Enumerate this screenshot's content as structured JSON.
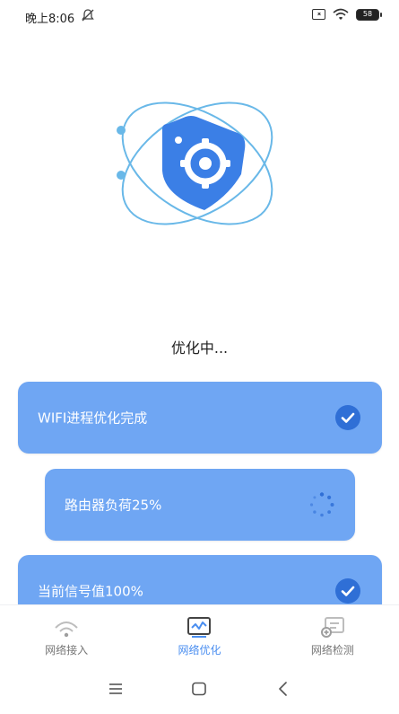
{
  "status_bar": {
    "time": "晚上8:06",
    "battery": "58"
  },
  "main": {
    "status_text": "优化中..."
  },
  "tasks": [
    {
      "label": "WIFI进程优化完成",
      "state": "done"
    },
    {
      "label": "路由器负荷25%",
      "state": "loading"
    },
    {
      "label": "当前信号值100%",
      "state": "done"
    }
  ],
  "tabs": [
    {
      "label": "网络接入",
      "icon": "wifi-icon",
      "active": false
    },
    {
      "label": "网络优化",
      "icon": "optimize-icon",
      "active": true
    },
    {
      "label": "网络检测",
      "icon": "detect-icon",
      "active": false
    }
  ],
  "colors": {
    "accent": "#6fa6f3",
    "accent_dark": "#3b7fe6",
    "orbit": "#69b8e8",
    "tab_active": "#4a8ef0"
  }
}
